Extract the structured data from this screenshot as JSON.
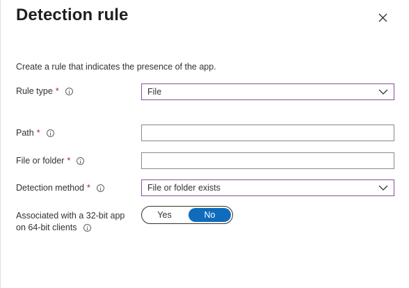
{
  "title": "Detection rule",
  "description": "Create a rule that indicates the presence of the app.",
  "required_marker": "*",
  "fields": {
    "rule_type": {
      "label": "Rule type",
      "value": "File"
    },
    "path": {
      "label": "Path",
      "value": ""
    },
    "file_or_folder": {
      "label": "File or folder",
      "value": ""
    },
    "detection_method": {
      "label": "Detection method",
      "value": "File or folder exists"
    }
  },
  "associated_32bit": {
    "label_line1": "Associated with a 32-bit app",
    "label_line2": "on 64-bit clients",
    "options": [
      "Yes",
      "No"
    ],
    "selected": "No"
  },
  "colors": {
    "accent": "#0f6cbd",
    "required": "#a4262c",
    "focus_border": "#8a4e9c"
  },
  "icons": {
    "close": "close-icon",
    "info": "info-icon",
    "chevron": "chevron-down-icon"
  }
}
